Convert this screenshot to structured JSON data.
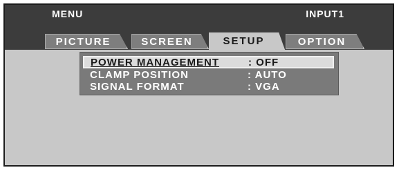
{
  "header": {
    "menu_label": "MENU",
    "input_label": "INPUT1"
  },
  "tabs": [
    {
      "label": "PICTURE",
      "active": false
    },
    {
      "label": "SCREEN",
      "active": false
    },
    {
      "label": "SETUP",
      "active": true
    },
    {
      "label": "OPTION",
      "active": false
    }
  ],
  "settings": [
    {
      "label": "POWER MANAGEMENT",
      "value": ": OFF",
      "selected": true
    },
    {
      "label": "CLAMP POSITION",
      "value": ": AUTO",
      "selected": false
    },
    {
      "label": "SIGNAL FORMAT",
      "value": ": VGA",
      "selected": false
    }
  ]
}
